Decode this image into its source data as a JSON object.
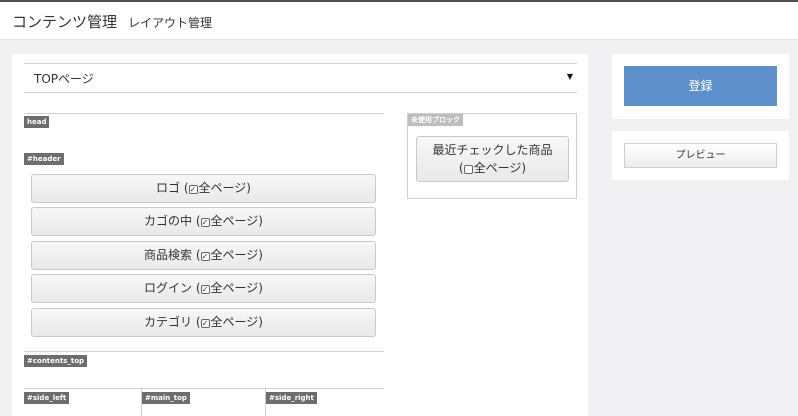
{
  "header": {
    "title": "コンテンツ管理",
    "subtitle": "レイアウト管理"
  },
  "page_select": {
    "value": "TOPページ",
    "caret": "▼"
  },
  "sections": {
    "head": "head",
    "header": "#header",
    "contents_top": "#contents_top",
    "side_left": "#side_left",
    "main_top": "#main_top",
    "side_right": "#side_right",
    "unused": "未使用ブロック"
  },
  "header_blocks": [
    {
      "label": "ロゴ",
      "suffix": "全ページ)",
      "checked": true
    },
    {
      "label": "カゴの中",
      "suffix": "全ページ)",
      "checked": true
    },
    {
      "label": "商品検索",
      "suffix": "全ページ)",
      "checked": true
    },
    {
      "label": "ログイン",
      "suffix": "全ページ)",
      "checked": true
    },
    {
      "label": "カテゴリ",
      "suffix": "全ページ)",
      "checked": true
    }
  ],
  "unused_block": {
    "label": "最近チェックした商品",
    "suffix": "全ページ)",
    "checked": false
  },
  "actions": {
    "register": "登録",
    "preview": "プレビュー"
  },
  "colors": {
    "accent": "#5d8fca",
    "tag": "#6d6d6d"
  }
}
